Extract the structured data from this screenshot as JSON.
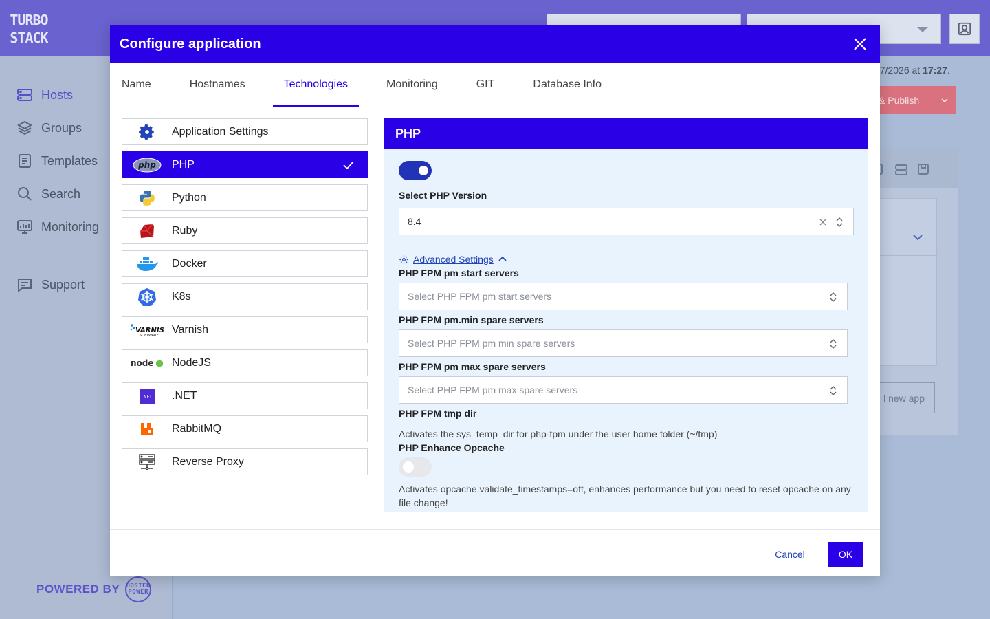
{
  "app": {
    "logo_text": "TURBO STACK",
    "powered_by": "POWERED BY",
    "powered_logo_text": "HOSTED POWER"
  },
  "sidebar": {
    "items": [
      {
        "label": "Hosts",
        "icon": "hosts-icon",
        "active": true
      },
      {
        "label": "Groups",
        "icon": "layers-icon"
      },
      {
        "label": "Templates",
        "icon": "document-icon"
      },
      {
        "label": "Search",
        "icon": "search-icon"
      },
      {
        "label": "Monitoring",
        "icon": "monitor-icon"
      },
      {
        "label": "Support",
        "icon": "chat-icon"
      }
    ]
  },
  "background": {
    "date_suffix": "07/2026",
    "at": "at",
    "time": "17:27",
    "period": ".",
    "publish_label": "& Publish",
    "new_app_label": "l new app"
  },
  "modal": {
    "title": "Configure application",
    "tabs": [
      {
        "label": "Name"
      },
      {
        "label": "Hostnames"
      },
      {
        "label": "Technologies",
        "active": true
      },
      {
        "label": "Monitoring"
      },
      {
        "label": "GIT"
      },
      {
        "label": "Database Info"
      }
    ],
    "technologies": [
      {
        "label": "Application Settings",
        "icon": "gear-icon"
      },
      {
        "label": "PHP",
        "icon": "php-icon",
        "active": true,
        "checked": true
      },
      {
        "label": "Python",
        "icon": "python-icon"
      },
      {
        "label": "Ruby",
        "icon": "ruby-icon"
      },
      {
        "label": "Docker",
        "icon": "docker-icon"
      },
      {
        "label": "K8s",
        "icon": "kubernetes-icon"
      },
      {
        "label": "Varnish",
        "icon": "varnish-icon"
      },
      {
        "label": "NodeJS",
        "icon": "nodejs-icon"
      },
      {
        "label": ".NET",
        "icon": "dotnet-icon"
      },
      {
        "label": "RabbitMQ",
        "icon": "rabbitmq-icon"
      },
      {
        "label": "Reverse Proxy",
        "icon": "server-icon"
      }
    ],
    "php": {
      "header": "PHP",
      "enabled": true,
      "version_label": "Select PHP Version",
      "version_value": "8.4",
      "advanced_label": "Advanced Settings",
      "fields": [
        {
          "label": "PHP FPM pm start servers",
          "placeholder": "Select PHP FPM pm start servers"
        },
        {
          "label": "PHP FPM pm.min spare servers",
          "placeholder": "Select PHP FPM pm min spare servers"
        },
        {
          "label": "PHP FPM pm max spare servers",
          "placeholder": "Select PHP FPM pm max spare servers"
        }
      ],
      "tmp_dir_label": "PHP FPM tmp dir",
      "tmp_dir_help": "Activates the sys_temp_dir for php-fpm under the user home folder (~/tmp)",
      "opcache_label": "PHP Enhance Opcache",
      "opcache_enabled": false,
      "opcache_help": "Activates opcache.validate_timestamps=off, enhances performance but you need to reset opcache on any file change!"
    },
    "cancel_label": "Cancel",
    "ok_label": "OK"
  },
  "colors": {
    "accent": "#2a00e6",
    "topbar": "#6a62cf",
    "panel_bg": "#e9f3fd",
    "link": "#2244b8"
  }
}
